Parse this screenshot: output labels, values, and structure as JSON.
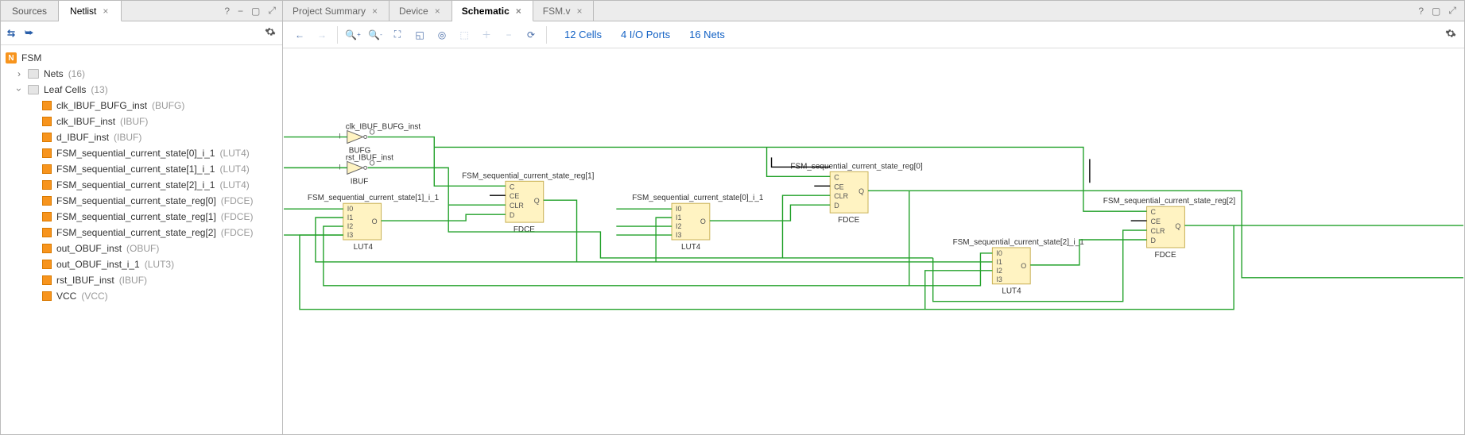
{
  "left": {
    "tabs": [
      {
        "label": "Sources",
        "active": false
      },
      {
        "label": "Netlist",
        "active": true
      }
    ],
    "root": "FSM",
    "nodes": {
      "nets": {
        "label": "Nets",
        "count": "(16)"
      },
      "leaf": {
        "label": "Leaf Cells",
        "count": "(13)"
      }
    },
    "cells": [
      {
        "name": "clk_IBUF_BUFG_inst",
        "type": "(BUFG)"
      },
      {
        "name": "clk_IBUF_inst",
        "type": "(IBUF)"
      },
      {
        "name": "d_IBUF_inst",
        "type": "(IBUF)"
      },
      {
        "name": "FSM_sequential_current_state[0]_i_1",
        "type": "(LUT4)"
      },
      {
        "name": "FSM_sequential_current_state[1]_i_1",
        "type": "(LUT4)"
      },
      {
        "name": "FSM_sequential_current_state[2]_i_1",
        "type": "(LUT4)"
      },
      {
        "name": "FSM_sequential_current_state_reg[0]",
        "type": "(FDCE)"
      },
      {
        "name": "FSM_sequential_current_state_reg[1]",
        "type": "(FDCE)"
      },
      {
        "name": "FSM_sequential_current_state_reg[2]",
        "type": "(FDCE)"
      },
      {
        "name": "out_OBUF_inst",
        "type": "(OBUF)"
      },
      {
        "name": "out_OBUF_inst_i_1",
        "type": "(LUT3)"
      },
      {
        "name": "rst_IBUF_inst",
        "type": "(IBUF)"
      },
      {
        "name": "VCC",
        "type": "(VCC)"
      }
    ]
  },
  "right": {
    "tabs": [
      {
        "label": "Project Summary",
        "active": false
      },
      {
        "label": "Device",
        "active": false
      },
      {
        "label": "Schematic",
        "active": true
      },
      {
        "label": "FSM.v",
        "active": false
      }
    ],
    "stats": {
      "cells": "12 Cells",
      "ports": "4 I/O Ports",
      "nets": "16 Nets"
    }
  },
  "schematic": {
    "blocks": {
      "bufg": {
        "title": "clk_IBUF_BUFG_inst",
        "sub": "BUFG",
        "in": "I",
        "out": "O"
      },
      "ibuf": {
        "title": "rst_IBUF_inst",
        "sub": "IBUF",
        "in": "I",
        "out": "O"
      },
      "lut1": {
        "title": "FSM_sequential_current_state[1]_i_1",
        "sub": "LUT4",
        "pins": [
          "I0",
          "I1",
          "I2",
          "I3"
        ],
        "out": "O"
      },
      "lut0": {
        "title": "FSM_sequential_current_state[0]_i_1",
        "sub": "LUT4",
        "pins": [
          "I0",
          "I1",
          "I2",
          "I3"
        ],
        "out": "O"
      },
      "lut2": {
        "title": "FSM_sequential_current_state[2]_i_1",
        "sub": "LUT4",
        "pins": [
          "I0",
          "I1",
          "I2",
          "I3"
        ],
        "out": "O"
      },
      "fdce1": {
        "title": "FSM_sequential_current_state_reg[1]",
        "sub": "FDCE",
        "pins": [
          "C",
          "CE",
          "CLR",
          "D"
        ],
        "out": "Q"
      },
      "fdce0": {
        "title": "FSM_sequential_current_state_reg[0]",
        "sub": "FDCE",
        "pins": [
          "C",
          "CE",
          "CLR",
          "D"
        ],
        "out": "Q"
      },
      "fdce2": {
        "title": "FSM_sequential_current_state_reg[2]",
        "sub": "FDCE",
        "pins": [
          "C",
          "CE",
          "CLR",
          "D"
        ],
        "out": "Q"
      }
    }
  }
}
